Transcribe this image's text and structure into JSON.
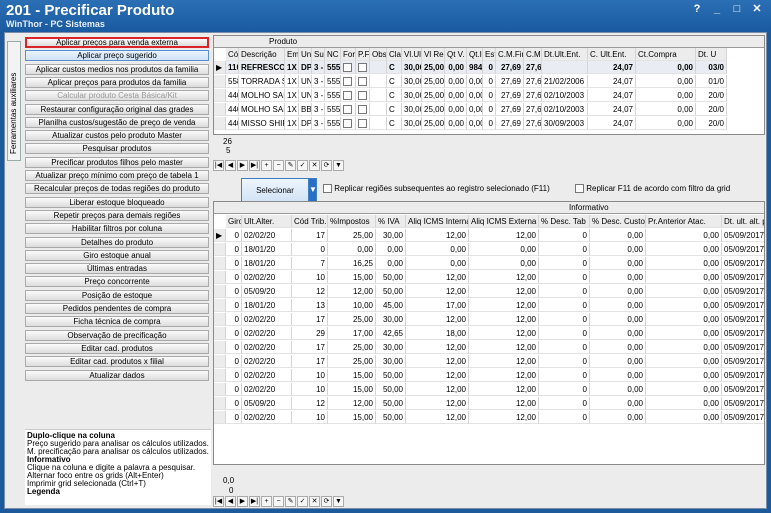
{
  "window": {
    "title": "201 - Precificar Produto",
    "subtitle": "WinThor - PC Sistemas",
    "help": "?",
    "min": "_",
    "max": "□",
    "close": "✕"
  },
  "sidebar_tab": "Ferramentas auxiliares",
  "buttons": [
    "Aplicar preços para venda externa",
    "Aplicar preço sugerido",
    "Aplicar custos medios nos produtos da familia",
    "Aplicar preços para produtos da familia",
    "Calcular produto Cesta Básica/Kit",
    "Restaurar configuração original das grades",
    "Planilha custos/sugestão de preço de venda",
    "Atualizar custos pelo produto Master",
    "Pesquisar produtos",
    "Precificar produtos filhos pelo master",
    "Atualizar preço mínimo com preço de tabela 1",
    "Recalcular preços de todas regiões do produto",
    "Liberar estoque bloqueado",
    "Repetir preços para demais regiões",
    "Habilitar filtros por coluna",
    "Detalhes do produto",
    "Giro estoque anual",
    "Últimas entradas",
    "Preço concorrente",
    "Posição de estoque",
    "Pedidos pendentes de compra",
    "Ficha técnica de compra",
    "Observação de precificação",
    "Editar cad. produtos",
    "Editar cad. produtos x filial",
    "Atualizar dados"
  ],
  "info": {
    "h1": "Duplo-clique na coluna",
    "l1": "Preço sugerido para analisar os cálculos utilizados.",
    "l2": "M. precificação para analisar os cálculos utilizados.",
    "h2": "Informativo",
    "l3": "Clique na coluna e digite a palavra a pesquisar.",
    "l4": "Alternar foco entre os grids (Alt+Enter)",
    "l5": "Imprimir grid selecionada (Ctrl+T)",
    "h3": "Legenda"
  },
  "top_grid": {
    "group": "Produto",
    "headers": [
      "Cód",
      "Descrição",
      "Em",
      "Un",
      "Suç",
      "NC",
      "For.",
      "P.F",
      "Obs",
      "Clas",
      "Vl.Ult",
      "Vl Repo",
      "Qt V.",
      "Qt.I",
      "Est",
      "C.M.Fin",
      "C.M.",
      "Dt.Ult.Ent.",
      "C. Ult.Ent.",
      "Ct.Compra",
      "Dt. U"
    ],
    "rows": [
      [
        "110",
        "REFRESCO",
        "1X",
        "DP",
        "3 -",
        "555",
        "",
        "",
        "",
        "C",
        "30,00",
        "25,00",
        "0,00",
        "984",
        "0",
        "27,69",
        "27,6",
        "",
        "24,07",
        "0,00",
        "03/0"
      ],
      [
        "558",
        "TORRADA S",
        "1X",
        "UN",
        "3 -",
        "555",
        "",
        "",
        "",
        "C",
        "30,00",
        "25,00",
        "0,00",
        "0,00",
        "0",
        "27,69",
        "27,6",
        "21/02/2006",
        "24,07",
        "0,00",
        "01/0"
      ],
      [
        "440",
        "MOLHO SAK",
        "1X",
        "UN",
        "3 -",
        "555",
        "",
        "",
        "",
        "C",
        "30,00",
        "25,00",
        "0,00",
        "0,00",
        "0",
        "27,69",
        "27,6",
        "02/10/2003",
        "24,07",
        "0,00",
        "20/0"
      ],
      [
        "440",
        "MOLHO SAK",
        "1X",
        "BB",
        "3 -",
        "555",
        "",
        "",
        "",
        "C",
        "30,00",
        "25,00",
        "0,00",
        "0,00",
        "0",
        "27,69",
        "27,6",
        "02/10/2003",
        "24,07",
        "0,00",
        "20/0"
      ],
      [
        "440",
        "MISSO SHIR",
        "1X",
        "DP",
        "3 -",
        "555",
        "",
        "",
        "",
        "C",
        "30,00",
        "25,00",
        "0,00",
        "0,00",
        "0",
        "27,69",
        "27,6",
        "30/09/2003",
        "24,07",
        "0,00",
        "20/0"
      ]
    ],
    "footer1": "26",
    "footer2": "5"
  },
  "actions": {
    "select": "Selecionar",
    "replicate": "Replicar regiões subsequentes ao registro selecionado (F11)",
    "replicate_filter": "Replicar F11 de acordo com filtro da grid"
  },
  "bottom_grid": {
    "group": "Informativo",
    "headers": [
      "Giro",
      "Ult.Alter.",
      "Cód Trib.",
      "%Impostos",
      "% IVA",
      "Aliq ICMS Interna",
      "Aliq ICMS Externa",
      "% Desc. Tab",
      "% Desc. Custo",
      "Pr.Anterior Atac.",
      "Dt. ult. alt. p. v"
    ],
    "rows": [
      [
        "0",
        "02/02/20",
        "17",
        "25,00",
        "30,00",
        "12,00",
        "12,00",
        "0",
        "0,00",
        "0,00",
        "05/09/2017 18"
      ],
      [
        "0",
        "18/01/20",
        "0",
        "0,00",
        "0,00",
        "0,00",
        "0,00",
        "0",
        "0,00",
        "0,00",
        "05/09/2017 18"
      ],
      [
        "0",
        "18/01/20",
        "7",
        "16,25",
        "0,00",
        "0,00",
        "0,00",
        "0",
        "0,00",
        "0,00",
        "05/09/2017 18"
      ],
      [
        "0",
        "02/02/20",
        "10",
        "15,00",
        "50,00",
        "12,00",
        "12,00",
        "0",
        "0,00",
        "0,00",
        "05/09/2017 18"
      ],
      [
        "0",
        "05/09/20",
        "12",
        "12,00",
        "50,00",
        "12,00",
        "12,00",
        "0",
        "0,00",
        "0,00",
        "05/09/2017 18"
      ],
      [
        "0",
        "18/01/20",
        "13",
        "10,00",
        "45,00",
        "17,00",
        "12,00",
        "0",
        "0,00",
        "0,00",
        "05/09/2017 18"
      ],
      [
        "0",
        "02/02/20",
        "17",
        "25,00",
        "30,00",
        "12,00",
        "12,00",
        "0",
        "0,00",
        "0,00",
        "05/09/2017 18"
      ],
      [
        "0",
        "02/02/20",
        "29",
        "17,00",
        "42,65",
        "18,00",
        "12,00",
        "0",
        "0,00",
        "0,00",
        "05/09/2017 18"
      ],
      [
        "0",
        "02/02/20",
        "17",
        "25,00",
        "30,00",
        "12,00",
        "12,00",
        "0",
        "0,00",
        "0,00",
        "05/09/2017 18"
      ],
      [
        "0",
        "02/02/20",
        "17",
        "25,00",
        "30,00",
        "12,00",
        "12,00",
        "0",
        "0,00",
        "0,00",
        "05/09/2017 18"
      ],
      [
        "0",
        "02/02/20",
        "10",
        "15,00",
        "50,00",
        "12,00",
        "12,00",
        "0",
        "0,00",
        "0,00",
        "05/09/2017 18"
      ],
      [
        "0",
        "02/02/20",
        "10",
        "15,00",
        "50,00",
        "12,00",
        "12,00",
        "0",
        "0,00",
        "0,00",
        "05/09/2017 18"
      ],
      [
        "0",
        "05/09/20",
        "12",
        "12,00",
        "50,00",
        "12,00",
        "12,00",
        "0",
        "0,00",
        "0,00",
        "05/09/2017 18"
      ],
      [
        "0",
        "02/02/20",
        "10",
        "15,00",
        "50,00",
        "12,00",
        "12,00",
        "0",
        "0,00",
        "0,00",
        "05/09/2017 18"
      ]
    ],
    "footer1": "0,0",
    "footer2": "0"
  },
  "nav_icons": [
    "first",
    "prev",
    "next",
    "last",
    "insert",
    "delete",
    "edit",
    "post",
    "cancel",
    "refresh",
    "filter"
  ]
}
